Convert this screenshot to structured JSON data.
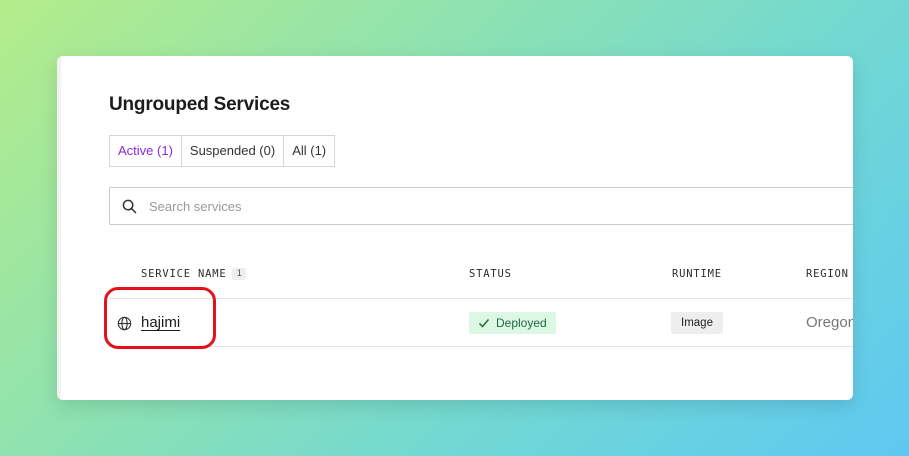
{
  "section": {
    "title": "Ungrouped Services"
  },
  "tabs": [
    {
      "label": "Active (1)",
      "active": true
    },
    {
      "label": "Suspended (0)",
      "active": false
    },
    {
      "label": "All (1)",
      "active": false
    }
  ],
  "search": {
    "placeholder": "Search services",
    "value": ""
  },
  "table": {
    "columns": {
      "service_name": "SERVICE NAME",
      "service_count": "1",
      "status": "STATUS",
      "runtime": "RUNTIME",
      "region": "REGION"
    },
    "rows": [
      {
        "icon": "globe-icon",
        "name": "hajimi",
        "status": "Deployed",
        "runtime": "Image",
        "region": "Oregon"
      }
    ]
  },
  "colors": {
    "active_tab": "#8a2be2",
    "status_bg": "#dcf7e4",
    "status_text": "#1f6b3a",
    "highlight": "#e5121d"
  }
}
